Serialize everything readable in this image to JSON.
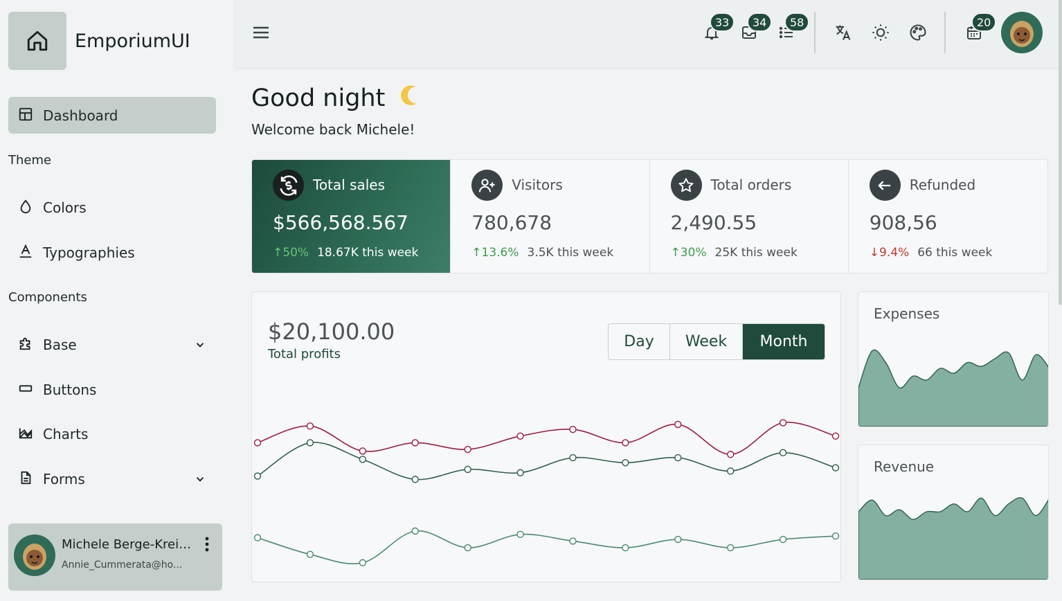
{
  "brand": {
    "name": "EmporiumUI",
    "icon": "home-icon"
  },
  "sidebar": {
    "dashboard_label": "Dashboard",
    "theme_section": "Theme",
    "colors_label": "Colors",
    "typographies_label": "Typographies",
    "components_section": "Components",
    "base_label": "Base",
    "buttons_label": "Buttons",
    "charts_label": "Charts",
    "forms_label": "Forms"
  },
  "user": {
    "name": "Michele Berge-Kreig...",
    "email": "Annie_Cummerata@ho..."
  },
  "topbar": {
    "notifications_count": "33",
    "inbox_count": "34",
    "tasks_count": "58",
    "calendar_count": "20"
  },
  "greeting": {
    "title": "Good night",
    "welcome": "Welcome back Michele!"
  },
  "stats": [
    {
      "title": "Total sales",
      "value": "$566,568.567",
      "trend": "50%",
      "trend_dir": "up",
      "week": "18.67K this week",
      "icon": "dollar-sync-icon"
    },
    {
      "title": "Visitors",
      "value": "780,678",
      "trend": "13.6%",
      "trend_dir": "up",
      "week": "3.5K this week",
      "icon": "user-add-icon"
    },
    {
      "title": "Total orders",
      "value": "2,490.55",
      "trend": "30%",
      "trend_dir": "up",
      "week": "25K this week",
      "icon": "star-icon"
    },
    {
      "title": "Refunded",
      "value": "908,56",
      "trend": "9.4%",
      "trend_dir": "down",
      "week": "66 this week",
      "icon": "return-arrow-icon"
    }
  ],
  "profits": {
    "value": "$20,100.00",
    "label": "Total profits",
    "periods": [
      "Day",
      "Week",
      "Month"
    ],
    "selected_period": "Month"
  },
  "chart_data": {
    "type": "line",
    "x": [
      0,
      1,
      2,
      3,
      4,
      5,
      6,
      7,
      8,
      9,
      10,
      11
    ],
    "series": [
      {
        "color": "#9b1b44",
        "values": [
          72,
          82,
          67,
          72,
          68,
          76,
          80,
          72,
          83,
          65,
          84,
          76
        ]
      },
      {
        "color": "#2e5e4e",
        "values": [
          52,
          72,
          62,
          50,
          56,
          54,
          63,
          60,
          63,
          55,
          66,
          57
        ]
      },
      {
        "color": "#4a8a74",
        "values": [
          15,
          5,
          0,
          19,
          9,
          17,
          13,
          9,
          14,
          9,
          14,
          16
        ]
      }
    ],
    "ylim": [
      -8,
      100
    ],
    "grid": false,
    "legend": "none"
  },
  "mini_charts": [
    {
      "title": "Expenses",
      "type": "area",
      "color": "#84b0a2",
      "values": [
        40,
        78,
        66,
        40,
        52,
        48,
        60,
        55,
        66,
        62,
        70,
        76,
        48,
        74,
        60
      ]
    },
    {
      "title": "Revenue",
      "type": "area",
      "color": "#84b0a2",
      "values": [
        70,
        82,
        66,
        72,
        62,
        70,
        70,
        78,
        70,
        84,
        66,
        78,
        84,
        66,
        84
      ]
    }
  ],
  "colors": {
    "accent": "#1f4a3c",
    "sidebar_active": "#c4ceca",
    "up": "#3d9b4c",
    "down": "#c23a2f"
  }
}
